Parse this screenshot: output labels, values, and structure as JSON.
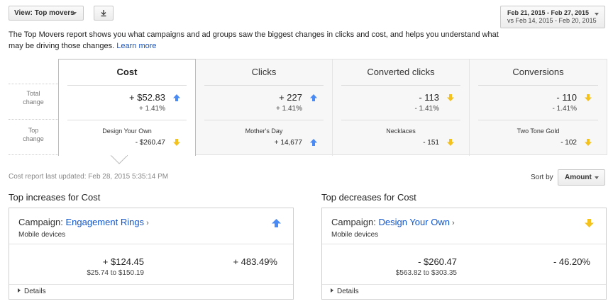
{
  "toolbar": {
    "view_label": "View: Top movers",
    "download_icon": "download-icon",
    "date_range_primary": "Feb 21, 2015 - Feb 27, 2015",
    "date_range_compare": "vs Feb 14, 2015 - Feb 20, 2015"
  },
  "intro": {
    "text": "The Top Movers report shows you what campaigns and ad groups saw the biggest changes in clicks and cost, and helps you understand what may be driving those changes. ",
    "learn_more": "Learn more"
  },
  "summary": {
    "row_labels": {
      "total": "Total change",
      "top": "Top change"
    },
    "columns": [
      {
        "header": "Cost",
        "total_value": "+ $52.83",
        "total_pct": "+ 1.41%",
        "total_dir": "up",
        "top_name": "Design Your Own",
        "top_value": "- $260.47",
        "top_dir": "down"
      },
      {
        "header": "Clicks",
        "total_value": "+ 227",
        "total_pct": "+ 1.41%",
        "total_dir": "up",
        "top_name": "Mother's Day",
        "top_value": "+ 14,677",
        "top_dir": "up"
      },
      {
        "header": "Converted clicks",
        "total_value": "- 113",
        "total_pct": "- 1.41%",
        "total_dir": "down",
        "top_name": "Necklaces",
        "top_value": "- 151",
        "top_dir": "down"
      },
      {
        "header": "Conversions",
        "total_value": "- 110",
        "total_pct": "- 1.41%",
        "total_dir": "down",
        "top_name": "Two Tone Gold",
        "top_value": "- 102",
        "top_dir": "down"
      }
    ]
  },
  "status": {
    "last_updated": "Cost report last updated: Feb 28, 2015 5:35:14 PM",
    "sort_by_label": "Sort by",
    "sort_value": "Amount"
  },
  "increases": {
    "title": "Top increases for Cost",
    "campaign_prefix": "Campaign: ",
    "campaign_name": "Engagement Rings",
    "device": "Mobile devices",
    "change": "+ $124.45",
    "range": "$25.74 to $150.19",
    "pct": "+ 483.49%",
    "details": "Details"
  },
  "decreases": {
    "title": "Top decreases for Cost",
    "campaign_prefix": "Campaign: ",
    "campaign_name": "Design Your Own",
    "device": "Mobile devices",
    "change": "- $260.47",
    "range": "$563.82 to $303.35",
    "pct": "- 46.20%",
    "details": "Details"
  },
  "colors": {
    "up": "#4a8af4",
    "down": "#f4c21f",
    "link": "#1155cc"
  }
}
